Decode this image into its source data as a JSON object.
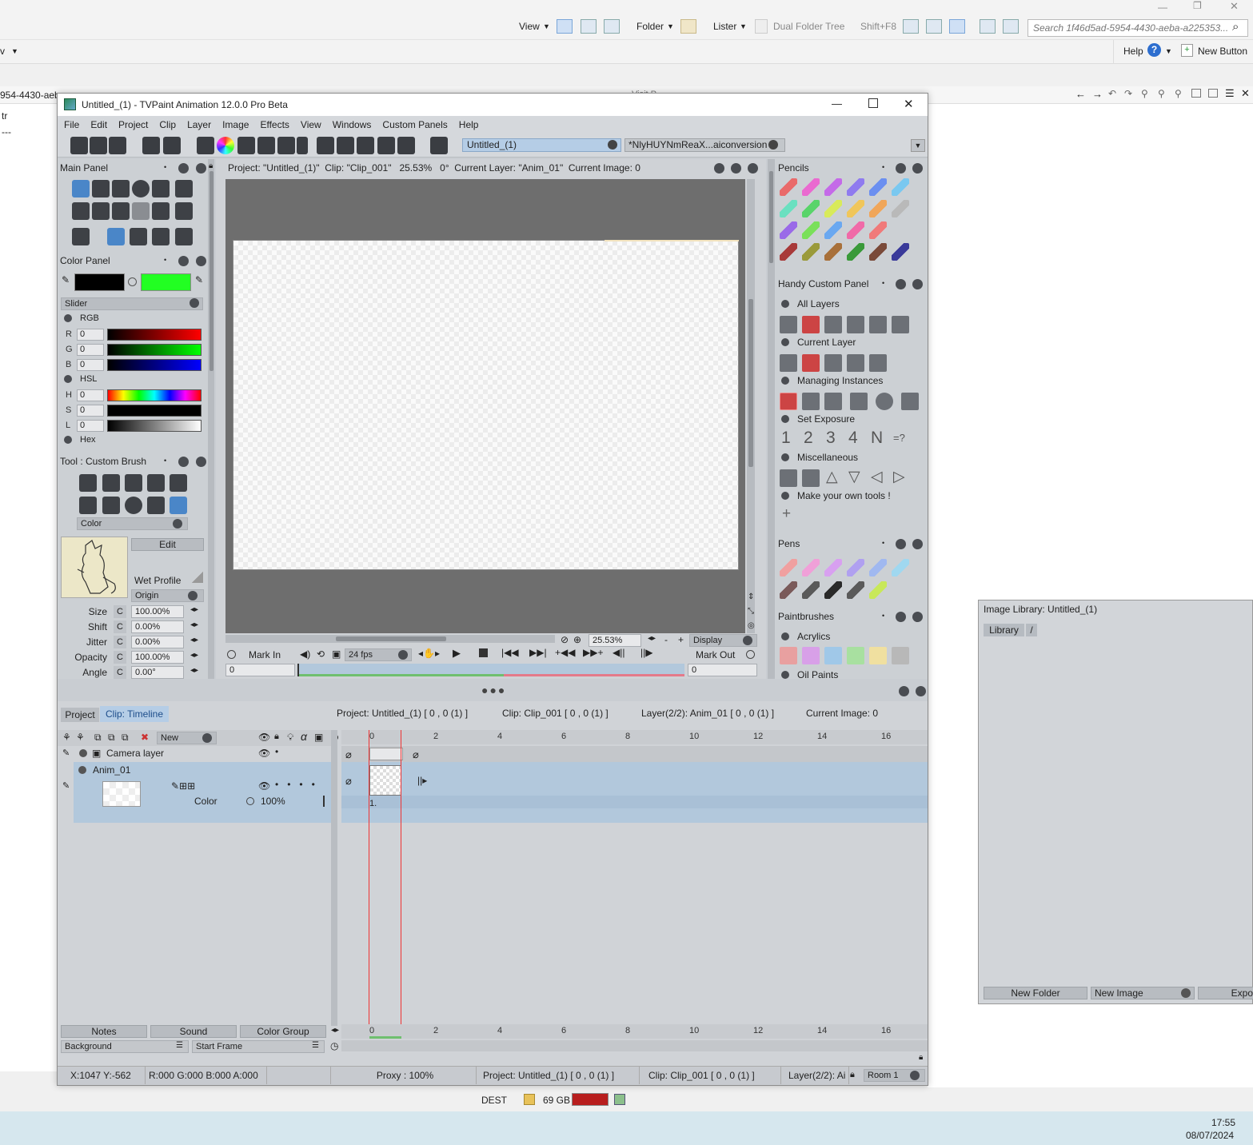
{
  "explorer": {
    "view_label": "View",
    "folder_label": "Folder",
    "lister_label": "Lister",
    "dual_folder_tree": "Dual Folder Tree",
    "shortcut": "Shift+F8",
    "search_placeholder": "Search 1f46d5ad-5954-4430-aeba-a225353...",
    "help_label": "Help",
    "new_button": "New Button",
    "path_fragment": "954-4430-aeb",
    "left_fragment": "tr",
    "left_fragment2": "---",
    "right_pane_fragment": "Visit P"
  },
  "window": {
    "title": "Untitled_(1) - TVPaint Animation 12.0.0 Pro Beta",
    "menu": [
      "File",
      "Edit",
      "Project",
      "Clip",
      "Layer",
      "Image",
      "Effects",
      "View",
      "Windows",
      "Custom Panels",
      "Help"
    ],
    "tabs": [
      "Untitled_(1)",
      "*NlyHUYNmReaX...aiconversion"
    ]
  },
  "main_panel": {
    "title": "Main Panel"
  },
  "color_panel": {
    "title": "Color Panel",
    "mode": "Slider",
    "rgb_label": "RGB",
    "hsl_label": "HSL",
    "hex_label": "Hex",
    "rows": [
      {
        "key": "R",
        "value": "0"
      },
      {
        "key": "G",
        "value": "0"
      },
      {
        "key": "B",
        "value": "0"
      },
      {
        "key": "H",
        "value": "0"
      },
      {
        "key": "S",
        "value": "0"
      },
      {
        "key": "L",
        "value": "0"
      }
    ],
    "primary_color": "#000000",
    "secondary_color": "#22ff22"
  },
  "tool_panel": {
    "title": "Tool : Custom Brush",
    "mode": "Color",
    "edit": "Edit",
    "wet_profile": "Wet Profile",
    "origin": "Origin",
    "params": [
      {
        "label": "Size",
        "flag": "C",
        "value": "100.00%"
      },
      {
        "label": "Shift",
        "flag": "C",
        "value": "0.00%"
      },
      {
        "label": "Jitter",
        "flag": "C",
        "value": "0.00%"
      },
      {
        "label": "Opacity",
        "flag": "C",
        "value": "100.00%"
      },
      {
        "label": "Angle",
        "flag": "C",
        "value": "0.00°"
      }
    ]
  },
  "canvas": {
    "info": "Project: \"Untitled_(1)\"  Clip: \"Clip_001\"   25.53%   0°  Current Layer: \"Anim_01\"  Current Image: 0",
    "zoom": "25.53%",
    "display": "Display",
    "mark_in": "Mark In",
    "mark_out": "Mark Out",
    "fps": "24 fps",
    "in_value": "0",
    "out_value": "0"
  },
  "pencils": {
    "title": "Pencils"
  },
  "handy": {
    "title": "Handy Custom Panel",
    "sections": [
      "All Layers",
      "Current Layer",
      "Managing Instances",
      "Set Exposure",
      "Miscellaneous",
      "Make your own tools !"
    ],
    "exposure": [
      "1",
      "2",
      "3",
      "4",
      "N"
    ]
  },
  "pens": {
    "title": "Pens"
  },
  "paintbrushes": {
    "title": "Paintbrushes",
    "sections": [
      "Acrylics",
      "Oil Paints"
    ]
  },
  "timeline": {
    "tabs": [
      "Project",
      "Clip: Timeline"
    ],
    "project_info": "Project: Untitled_(1) [ 0 , 0  (1) ]",
    "clip_info": "Clip: Clip_001 [ 0 , 0  (1) ]",
    "layer_info": "Layer(2/2): Anim_01 [ 0 , 0  (1) ]",
    "current_image": "Current Image: 0",
    "new_label": "New",
    "camera_layer": "Camera layer",
    "anim_layer": "Anim_01",
    "blend_mode": "Color",
    "opacity": "100%",
    "frame_label": "1.",
    "ticks": [
      "0",
      "2",
      "4",
      "6",
      "8",
      "10",
      "12",
      "14",
      "16"
    ],
    "bottom_buttons": [
      "Notes",
      "Sound",
      "Color Group"
    ],
    "background": "Background",
    "start_frame": "Start Frame"
  },
  "statusbar": {
    "coords": "X:1047  Y:-562",
    "rgba": "R:000 G:000 B:000 A:000",
    "proxy": "Proxy : 100%",
    "project": "Project: Untitled_(1) [ 0 , 0  (1) ]",
    "clip": "Clip: Clip_001 [ 0 , 0  (1) ]",
    "layer": "Layer(2/2): Ai",
    "room": "Room 1"
  },
  "image_library": {
    "title": "Image Library: Untitled_(1)",
    "library_tab": "Library",
    "slash": "/",
    "new_folder": "New Folder",
    "new_image": "New Image",
    "export_fragment": "Expo"
  },
  "bottom_bar": {
    "dest": "DEST",
    "disk": "69 GB"
  },
  "clock": {
    "time": "17:55",
    "date": "08/07/2024"
  }
}
